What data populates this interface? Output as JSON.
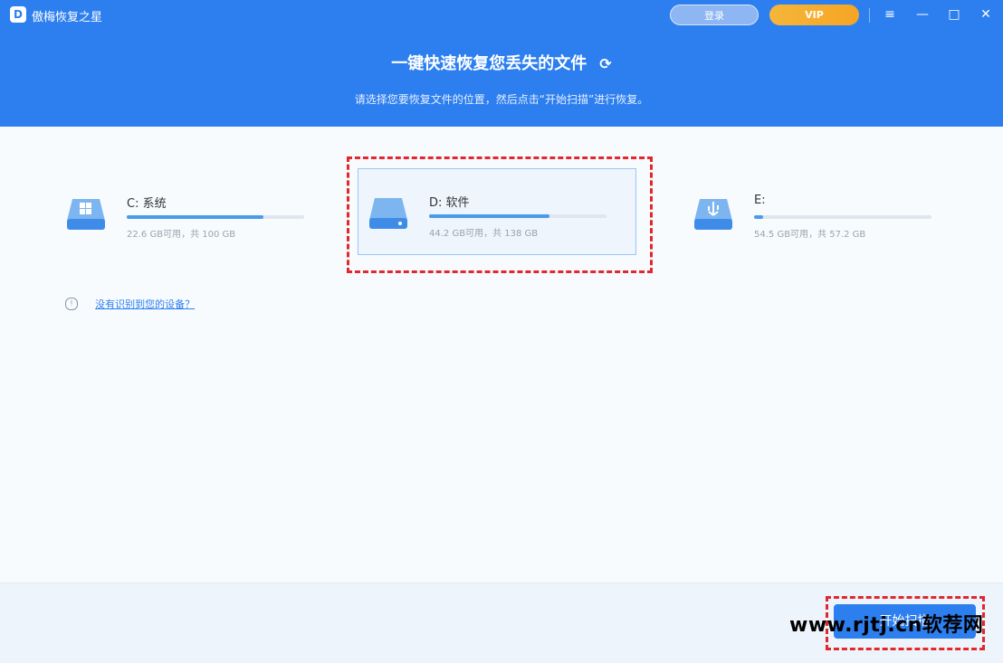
{
  "titlebar": {
    "app_name": "傲梅恢复之星",
    "logo_letter": "D",
    "login_label": "登录",
    "vip_label": "VIP",
    "menu_glyph": "≡",
    "minimize_glyph": "—",
    "maximize_glyph": "□",
    "close_glyph": "✕"
  },
  "header": {
    "title": "一键快速恢复您丢失的文件",
    "refresh_glyph": "⟳",
    "subtitle": "请选择您要恢复文件的位置，然后点击“开始扫描”进行恢复。"
  },
  "drives": [
    {
      "name": "C: 系统",
      "free": "22.6 GB可用",
      "total": "共 100 GB",
      "used_fraction": 0.77,
      "icon": "windows-drive-icon",
      "selected": false
    },
    {
      "name": "D: 软件",
      "free": "44.2 GB可用",
      "total": "共 138 GB",
      "used_fraction": 0.68,
      "icon": "hard-drive-icon",
      "selected": true
    },
    {
      "name": "E:",
      "free": "54.5 GB可用",
      "total": "共 57.2 GB",
      "used_fraction": 0.05,
      "icon": "usb-drive-icon",
      "selected": false
    }
  ],
  "help": {
    "icon": "info-icon",
    "link_text": "没有识别到您的设备？"
  },
  "footer": {
    "start_scan_label": "开始扫描"
  },
  "watermark": "www.rjtj.cn软荐网",
  "colors": {
    "brand_blue": "#2d7ff0",
    "vip_gold": "#f5b63a",
    "highlight_red": "#e0282e"
  }
}
